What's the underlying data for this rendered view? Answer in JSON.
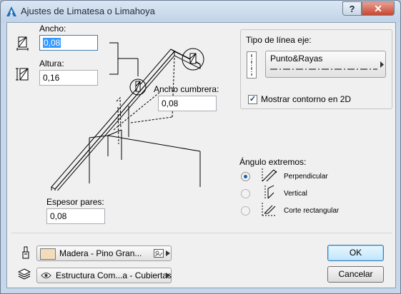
{
  "window": {
    "title": "Ajustes de Limatesa o Limahoya"
  },
  "titlebar": {
    "help_label": "?",
    "close_label": "✕"
  },
  "fields": {
    "ancho": {
      "label": "Ancho:",
      "value": "0,08"
    },
    "altura": {
      "label": "Altura:",
      "value": "0,16"
    },
    "ancho_cumbrera": {
      "label": "Ancho cumbrera:",
      "value": "0,08"
    },
    "espesor_pares": {
      "label": "Espesor pares:",
      "value": "0,08"
    }
  },
  "line_type": {
    "label": "Tipo de línea eje:",
    "selected": "Punto&Rayas"
  },
  "show_contour": {
    "label": "Mostrar contorno en 2D",
    "checked": true
  },
  "end_angle": {
    "label": "Ángulo extremos:",
    "options": [
      {
        "label": "Perpendicular",
        "selected": true
      },
      {
        "label": "Vertical",
        "selected": false
      },
      {
        "label": "Corte rectangular",
        "selected": false
      }
    ]
  },
  "material": {
    "name": "Madera - Pino Gran...",
    "swatch_color": "#f3dcbc"
  },
  "layer": {
    "name": "Estructura Com...a - Cubiertas"
  },
  "buttons": {
    "ok": "OK",
    "cancel": "Cancelar"
  }
}
